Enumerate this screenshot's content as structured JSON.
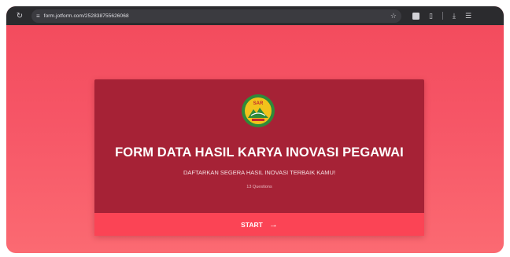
{
  "browser": {
    "url": "form.jotform.com/252838755626068",
    "icons": [
      "reload-icon",
      "site-settings-icon",
      "bookmark-star-icon",
      "extension-icon",
      "tab-icon",
      "download-icon",
      "menu-icon"
    ]
  },
  "form": {
    "logo_text": "SAR",
    "title": "FORM DATA HASIL KARYA INOVASI PEGAWAI",
    "subtitle": "DAFTARKAN SEGERA HASIL INOVASI TERBAIK KAMU!",
    "questions": "13 Questions",
    "start_label": "START",
    "start_arrow": "→"
  },
  "colors": {
    "background": "#f65566",
    "card": "#a62236",
    "start_bar": "#fb4455",
    "logo_ring": "#2f8a3a",
    "logo_fill": "#f2c21b"
  }
}
